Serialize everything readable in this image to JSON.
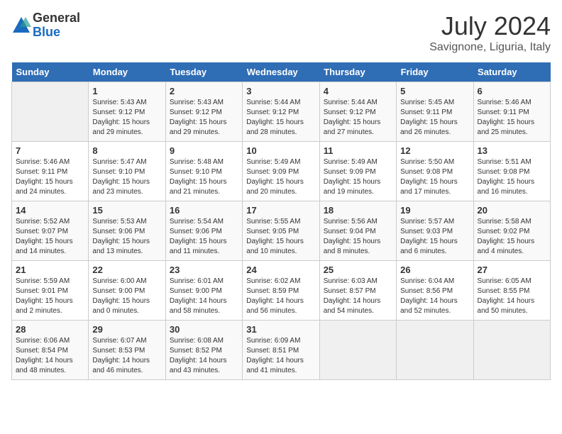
{
  "logo": {
    "general": "General",
    "blue": "Blue"
  },
  "title": "July 2024",
  "location": "Savignone, Liguria, Italy",
  "weekdays": [
    "Sunday",
    "Monday",
    "Tuesday",
    "Wednesday",
    "Thursday",
    "Friday",
    "Saturday"
  ],
  "weeks": [
    [
      {
        "day": "",
        "empty": true
      },
      {
        "day": "1",
        "sunrise": "5:43 AM",
        "sunset": "9:12 PM",
        "daylight": "15 hours and 29 minutes."
      },
      {
        "day": "2",
        "sunrise": "5:43 AM",
        "sunset": "9:12 PM",
        "daylight": "15 hours and 29 minutes."
      },
      {
        "day": "3",
        "sunrise": "5:44 AM",
        "sunset": "9:12 PM",
        "daylight": "15 hours and 28 minutes."
      },
      {
        "day": "4",
        "sunrise": "5:44 AM",
        "sunset": "9:12 PM",
        "daylight": "15 hours and 27 minutes."
      },
      {
        "day": "5",
        "sunrise": "5:45 AM",
        "sunset": "9:11 PM",
        "daylight": "15 hours and 26 minutes."
      },
      {
        "day": "6",
        "sunrise": "5:46 AM",
        "sunset": "9:11 PM",
        "daylight": "15 hours and 25 minutes."
      }
    ],
    [
      {
        "day": "7",
        "sunrise": "5:46 AM",
        "sunset": "9:11 PM",
        "daylight": "15 hours and 24 minutes."
      },
      {
        "day": "8",
        "sunrise": "5:47 AM",
        "sunset": "9:10 PM",
        "daylight": "15 hours and 23 minutes."
      },
      {
        "day": "9",
        "sunrise": "5:48 AM",
        "sunset": "9:10 PM",
        "daylight": "15 hours and 21 minutes."
      },
      {
        "day": "10",
        "sunrise": "5:49 AM",
        "sunset": "9:09 PM",
        "daylight": "15 hours and 20 minutes."
      },
      {
        "day": "11",
        "sunrise": "5:49 AM",
        "sunset": "9:09 PM",
        "daylight": "15 hours and 19 minutes."
      },
      {
        "day": "12",
        "sunrise": "5:50 AM",
        "sunset": "9:08 PM",
        "daylight": "15 hours and 17 minutes."
      },
      {
        "day": "13",
        "sunrise": "5:51 AM",
        "sunset": "9:08 PM",
        "daylight": "15 hours and 16 minutes."
      }
    ],
    [
      {
        "day": "14",
        "sunrise": "5:52 AM",
        "sunset": "9:07 PM",
        "daylight": "15 hours and 14 minutes."
      },
      {
        "day": "15",
        "sunrise": "5:53 AM",
        "sunset": "9:06 PM",
        "daylight": "15 hours and 13 minutes."
      },
      {
        "day": "16",
        "sunrise": "5:54 AM",
        "sunset": "9:06 PM",
        "daylight": "15 hours and 11 minutes."
      },
      {
        "day": "17",
        "sunrise": "5:55 AM",
        "sunset": "9:05 PM",
        "daylight": "15 hours and 10 minutes."
      },
      {
        "day": "18",
        "sunrise": "5:56 AM",
        "sunset": "9:04 PM",
        "daylight": "15 hours and 8 minutes."
      },
      {
        "day": "19",
        "sunrise": "5:57 AM",
        "sunset": "9:03 PM",
        "daylight": "15 hours and 6 minutes."
      },
      {
        "day": "20",
        "sunrise": "5:58 AM",
        "sunset": "9:02 PM",
        "daylight": "15 hours and 4 minutes."
      }
    ],
    [
      {
        "day": "21",
        "sunrise": "5:59 AM",
        "sunset": "9:01 PM",
        "daylight": "15 hours and 2 minutes."
      },
      {
        "day": "22",
        "sunrise": "6:00 AM",
        "sunset": "9:00 PM",
        "daylight": "15 hours and 0 minutes."
      },
      {
        "day": "23",
        "sunrise": "6:01 AM",
        "sunset": "9:00 PM",
        "daylight": "14 hours and 58 minutes."
      },
      {
        "day": "24",
        "sunrise": "6:02 AM",
        "sunset": "8:59 PM",
        "daylight": "14 hours and 56 minutes."
      },
      {
        "day": "25",
        "sunrise": "6:03 AM",
        "sunset": "8:57 PM",
        "daylight": "14 hours and 54 minutes."
      },
      {
        "day": "26",
        "sunrise": "6:04 AM",
        "sunset": "8:56 PM",
        "daylight": "14 hours and 52 minutes."
      },
      {
        "day": "27",
        "sunrise": "6:05 AM",
        "sunset": "8:55 PM",
        "daylight": "14 hours and 50 minutes."
      }
    ],
    [
      {
        "day": "28",
        "sunrise": "6:06 AM",
        "sunset": "8:54 PM",
        "daylight": "14 hours and 48 minutes."
      },
      {
        "day": "29",
        "sunrise": "6:07 AM",
        "sunset": "8:53 PM",
        "daylight": "14 hours and 46 minutes."
      },
      {
        "day": "30",
        "sunrise": "6:08 AM",
        "sunset": "8:52 PM",
        "daylight": "14 hours and 43 minutes."
      },
      {
        "day": "31",
        "sunrise": "6:09 AM",
        "sunset": "8:51 PM",
        "daylight": "14 hours and 41 minutes."
      },
      {
        "day": "",
        "empty": true
      },
      {
        "day": "",
        "empty": true
      },
      {
        "day": "",
        "empty": true
      }
    ]
  ],
  "labels": {
    "sunrise": "Sunrise:",
    "sunset": "Sunset:",
    "daylight": "Daylight:"
  }
}
